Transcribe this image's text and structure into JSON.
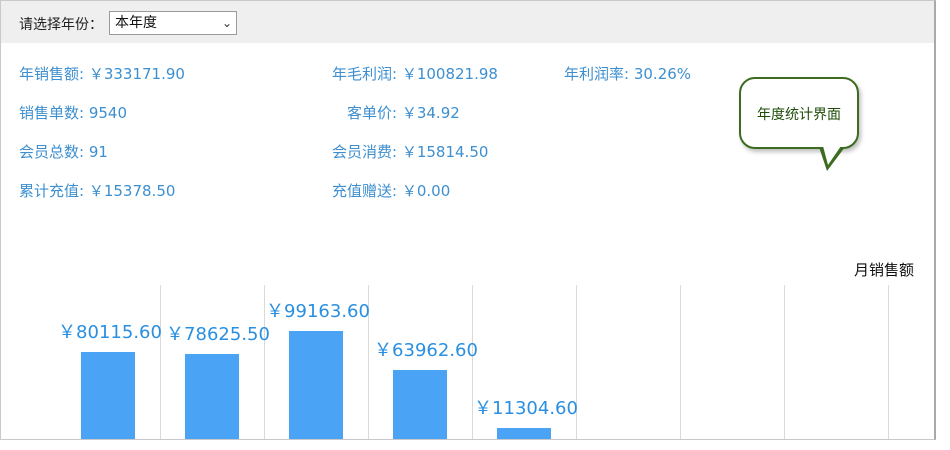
{
  "toolbar": {
    "year_label": "请选择年份：",
    "year_select_value": "本年度"
  },
  "stats": {
    "sales_amount": {
      "label": "年销售额:",
      "value": "￥333171.90"
    },
    "gross_profit": {
      "label": "年毛利润:",
      "value": "￥100821.98"
    },
    "profit_rate": {
      "label": "年利润率:",
      "value": "30.26%"
    },
    "order_count": {
      "label": "销售单数:",
      "value": "9540"
    },
    "avg_order": {
      "label": "客单价:",
      "value": "￥34.92"
    },
    "member_total": {
      "label": "会员总数:",
      "value": "91"
    },
    "member_spend": {
      "label": "会员消费:",
      "value": "￥15814.50"
    },
    "total_recharge": {
      "label": "累计充值:",
      "value": "￥15378.50"
    },
    "recharge_bonus": {
      "label": "充值赠送:",
      "value": "￥0.00"
    }
  },
  "callout": {
    "text": "年度统计界面"
  },
  "colors": {
    "accent_text": "#3d8fcf",
    "bar": "#4aa3f5",
    "callout_border": "#3d6b1f"
  },
  "chart_data": {
    "type": "bar",
    "title": "月销售额",
    "categories": [
      "",
      "",
      "",
      "",
      "",
      "",
      "",
      "",
      ""
    ],
    "values": [
      80115.6,
      78625.5,
      99163.6,
      63962.6,
      11304.6,
      0,
      0,
      0,
      0
    ],
    "labels": [
      "￥80115.60",
      "￥78625.50",
      "￥99163.60",
      "￥63962.60",
      "￥11304.60",
      "",
      "",
      "",
      ""
    ],
    "grid": true
  }
}
